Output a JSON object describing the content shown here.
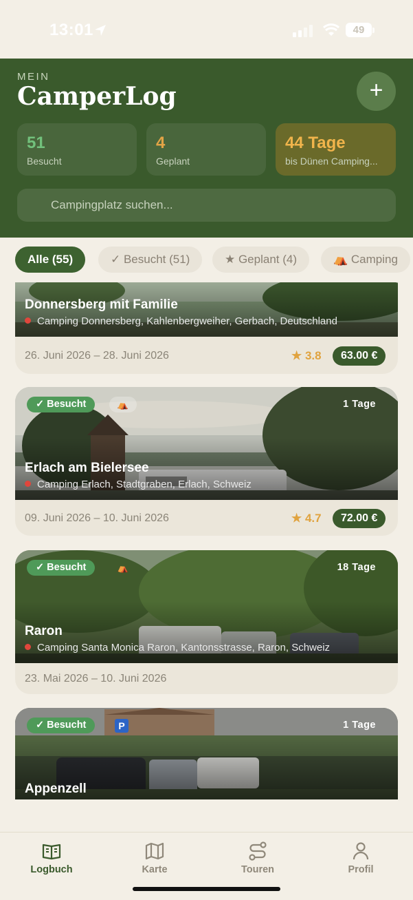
{
  "status_bar": {
    "time": "13:01",
    "battery": "49"
  },
  "header": {
    "eyebrow": "MEIN",
    "title": "CamperLog",
    "add_label": "+",
    "stats": [
      {
        "value": "51",
        "label": "Besucht"
      },
      {
        "value": "4",
        "label": "Geplant"
      },
      {
        "value": "44 Tage",
        "label": "bis Dünen Camping..."
      }
    ],
    "search_placeholder": "Campingplatz suchen..."
  },
  "filters": [
    {
      "label": "Alle (55)",
      "active": true
    },
    {
      "label": "✓ Besucht (51)",
      "active": false
    },
    {
      "label": "★ Geplant (4)",
      "active": false
    },
    {
      "label": "⛺ Camping",
      "active": false
    }
  ],
  "entries": [
    {
      "name": "Donnersberg mit Familie",
      "address": "Camping Donnersberg, Kahlenbergweiher, Gerbach, Deutschland",
      "dates": "26. Juni 2026 – 28. Juni 2026",
      "rating": "★ 3.8",
      "price": "63.00 €"
    },
    {
      "badge": "✓ Besucht",
      "type_icon": "⛺",
      "days": "1 Tage",
      "name": "Erlach am Bielersee",
      "address": "Camping Erlach, Stadtgraben, Erlach, Schweiz",
      "dates": "09. Juni 2026 – 10. Juni 2026",
      "rating": "★ 4.7",
      "price": "72.00 €"
    },
    {
      "badge": "✓ Besucht",
      "type_icon": "⛺",
      "days": "18 Tage",
      "name": "Raron",
      "address": "Camping Santa Monica Raron, Kantonsstrasse, Raron, Schweiz",
      "dates": "23. Mai 2026 – 10. Juni 2026"
    },
    {
      "badge": "✓ Besucht",
      "type_icon": "P",
      "days": "1 Tage",
      "name": "Appenzell"
    }
  ],
  "tabs": [
    {
      "label": "Logbuch",
      "active": true
    },
    {
      "label": "Karte",
      "active": false
    },
    {
      "label": "Touren",
      "active": false
    },
    {
      "label": "Profil",
      "active": false
    }
  ],
  "colors": {
    "header_bg": "#3a5a2c",
    "visited_green": "#4f9a59",
    "planned_orange": "#e2a446",
    "page_bg": "#f3efe6"
  }
}
